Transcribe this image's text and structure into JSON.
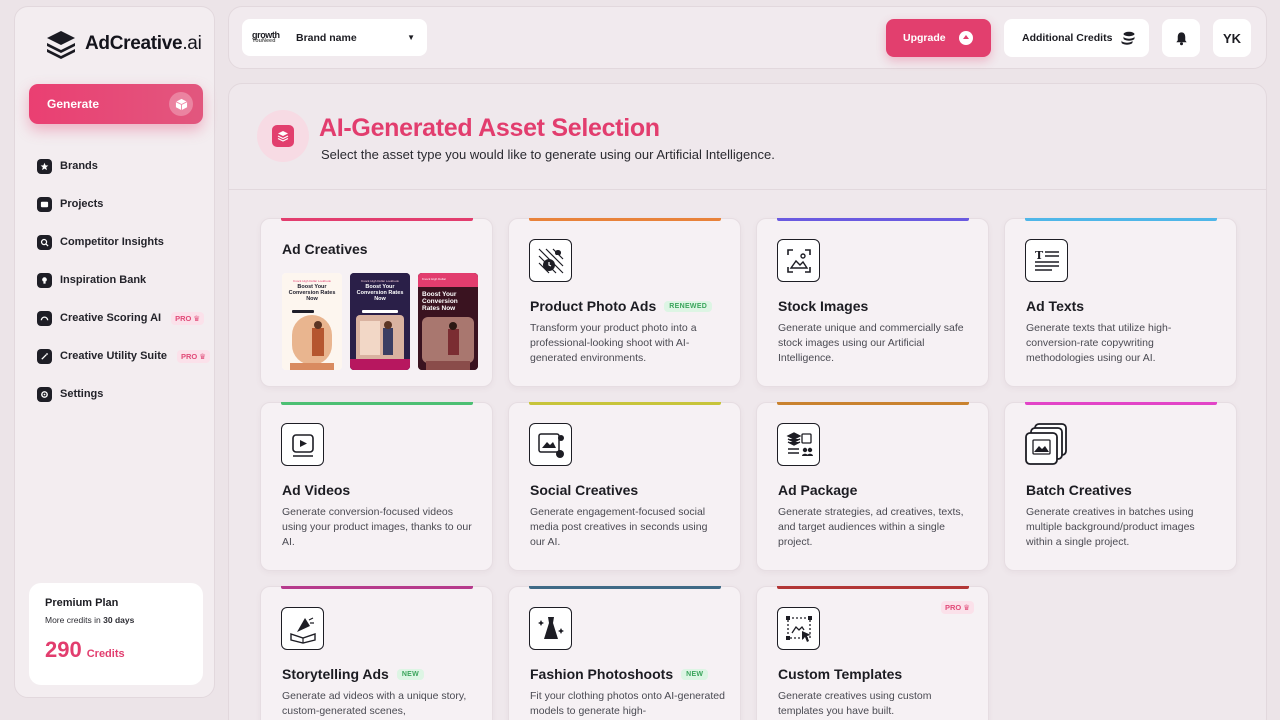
{
  "sidebar": {
    "logo": {
      "name": "AdCreative",
      "suffix": ".ai",
      "icon": "layers-logo-icon"
    },
    "generate_label": "Generate",
    "nav": [
      {
        "label": "Brands",
        "icon": "star-icon",
        "pro": false
      },
      {
        "label": "Projects",
        "icon": "folder-icon",
        "pro": false
      },
      {
        "label": "Competitor Insights",
        "icon": "search-icon",
        "pro": false
      },
      {
        "label": "Inspiration Bank",
        "icon": "bulb-icon",
        "pro": false
      },
      {
        "label": "Creative Scoring AI",
        "icon": "gauge-icon",
        "pro": true
      },
      {
        "label": "Creative Utility Suite",
        "icon": "wand-icon",
        "pro": true
      },
      {
        "label": "Settings",
        "icon": "gear-icon",
        "pro": false
      }
    ],
    "pro_label": "PRO",
    "plan": {
      "title": "Premium Plan",
      "sub_prefix": "More credits in",
      "sub_days": "30 days",
      "credits": "290",
      "credits_unit": "Credits"
    }
  },
  "topbar": {
    "brand_logo_line1": "growth",
    "brand_logo_line2": "YouNeed",
    "brand_name": "Brand name",
    "upgrade": "Upgrade",
    "additional_credits": "Additional Credits",
    "avatar": "YK"
  },
  "header": {
    "title": "AI-Generated Asset Selection",
    "subtitle": "Select the asset type you would like to generate using our Artificial Intelligence."
  },
  "ad_creatives": {
    "title": "Ad Creatives",
    "thumbs": [
      {
        "eyebrow": "Knock High Dollar Lookbook",
        "headline": "Boost Your Conversion Rates Now"
      },
      {
        "eyebrow": "Knock High Dollar Lookbook",
        "headline": "Boost Your Conversion Rates Now"
      },
      {
        "eyebrow": "Knock High Dollar",
        "headline": "Boost Your Conversion Rates Now"
      }
    ]
  },
  "cards": [
    {
      "title": "Product Photo Ads",
      "tag": "RENEWED",
      "desc": "Transform your product photo into a professional-looking shoot with AI-generated environments.",
      "accent": "#e8823a",
      "icon": "product-photo-icon"
    },
    {
      "title": "Stock Images",
      "tag": "",
      "desc": "Generate unique and commercially safe stock images using our Artificial Intelligence.",
      "accent": "#6a5ae0",
      "icon": "image-icon"
    },
    {
      "title": "Ad Texts",
      "tag": "",
      "desc": "Generate texts that utilize high-conversion-rate copywriting methodologies using our AI.",
      "accent": "#4fb6e8",
      "icon": "text-icon"
    },
    {
      "title": "Ad Videos",
      "tag": "",
      "desc": "Generate conversion-focused videos using your product images, thanks to our AI.",
      "accent": "#4cbf73",
      "icon": "video-icon"
    },
    {
      "title": "Social Creatives",
      "tag": "",
      "desc": "Generate engagement-focused social media post creatives in seconds using our AI.",
      "accent": "#c7c43a",
      "icon": "social-icon"
    },
    {
      "title": "Ad Package",
      "tag": "",
      "desc": "Generate strategies, ad creatives, texts, and target audiences within a single project.",
      "accent": "#c9822e",
      "icon": "package-icon"
    },
    {
      "title": "Batch Creatives",
      "tag": "",
      "desc": "Generate creatives in batches using multiple background/product images within a single project.",
      "accent": "#e244c7",
      "icon": "batch-icon"
    },
    {
      "title": "Storytelling Ads",
      "tag": "NEW",
      "desc": "Generate ad videos with a unique story, custom-generated scenes,",
      "accent": "#b63a8c",
      "icon": "story-icon"
    },
    {
      "title": "Fashion Photoshoots",
      "tag": "NEW",
      "desc": "Fit your clothing photos onto AI-generated models to generate high-",
      "accent": "#3f6a86",
      "icon": "dress-icon"
    },
    {
      "title": "Custom Templates",
      "tag": "",
      "desc": "Generate creatives using custom templates you have  built.",
      "accent": "#b23636",
      "icon": "template-icon",
      "pro": true
    }
  ],
  "colors": {
    "brand": "#e23d6e",
    "text": "#1c1c22"
  }
}
